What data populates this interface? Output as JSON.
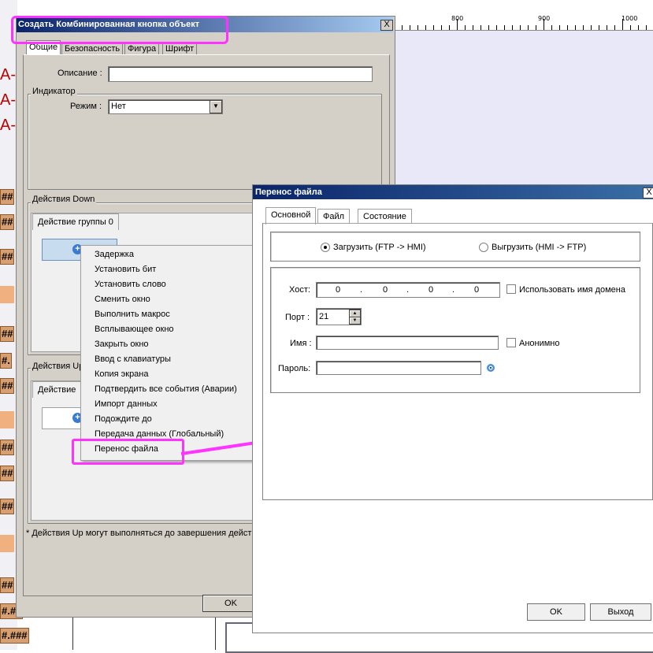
{
  "ruler": {
    "labels": [
      "800",
      "900",
      "1000"
    ]
  },
  "background": {
    "red_labels": [
      "A-0",
      "A-",
      "A-1"
    ],
    "hash_labels": [
      "##",
      "##",
      "##",
      "##",
      "#.",
      "##",
      "##",
      "##",
      "##",
      "##",
      "##",
      "#.##",
      "#.###"
    ]
  },
  "dialog1": {
    "title": "Создать Комбинированная кнопка объект",
    "close": "X",
    "tabs": [
      "Общие",
      "Безопасность",
      "Фигура",
      "Шрифт"
    ],
    "description_label": "Описание :",
    "description_value": "",
    "indicator_group": "Индикатор",
    "mode_label": "Режим :",
    "mode_value": "Нет",
    "down_group": "Действия Down",
    "down_tab": "Действие группы 0",
    "up_group": "Действия Up",
    "up_tab": "Действие",
    "note": "* Действия Up могут выполняться до завершения дейст",
    "ok": "OK"
  },
  "context_menu": {
    "items": [
      "Задержка",
      "Установить бит",
      "Установить слово",
      "Сменить окно",
      "Выполнить макрос",
      "Всплывающее окно",
      "Закрыть окно",
      "Ввод с клавиатуры",
      "Копия экрана",
      "Подтвердить все события  (Аварии)",
      "Импорт данных",
      "Подождите до",
      "Передача данных (Глобальный)",
      "Перенос файла"
    ]
  },
  "dialog2": {
    "title": "Перенос файла",
    "close": "X",
    "tabs": [
      "Основной",
      "Файл",
      "Состояние"
    ],
    "radio_upload": "Загрузить (FTP -> HMI)",
    "radio_download": "Выгрузить (HMI -> FTP)",
    "host_label": "Хост:",
    "host_octets": [
      "0",
      "0",
      "0",
      "0"
    ],
    "use_domain_label": "Использовать имя домена",
    "port_label": "Порт :",
    "port_value": "21",
    "name_label": "Имя :",
    "name_value": "",
    "anon_label": "Анонимно",
    "password_label": "Пароль:",
    "password_value": "",
    "ok": "OK",
    "exit": "Выход"
  },
  "colors": {
    "highlight": "#ff33ff",
    "title_blue": "#0a246a",
    "label_bg": "#d8a070"
  },
  "icons": [
    "close-icon",
    "dropdown-arrow-icon",
    "add-action-icon",
    "spin-up-icon",
    "spin-down-icon",
    "eye-icon",
    "arrow-annotation"
  ]
}
